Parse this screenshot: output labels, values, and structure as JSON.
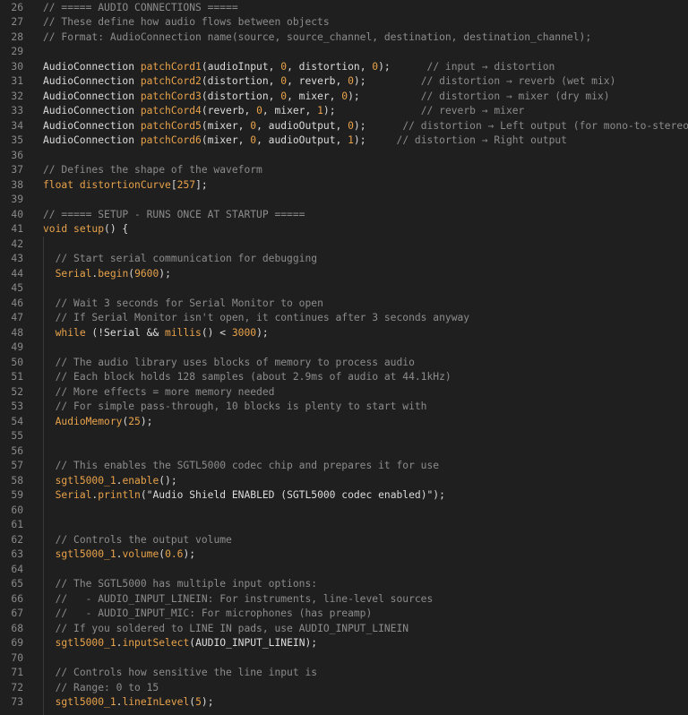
{
  "lines": [
    {
      "n": "26",
      "segs": [
        [
          "c",
          "// ===== AUDIO CONNECTIONS ====="
        ]
      ]
    },
    {
      "n": "27",
      "segs": [
        [
          "c",
          "// These define how audio flows between objects"
        ]
      ]
    },
    {
      "n": "28",
      "segs": [
        [
          "c",
          "// Format: AudioConnection name(source, source_channel, destination, destination_channel);"
        ]
      ]
    },
    {
      "n": "29",
      "segs": []
    },
    {
      "n": "30",
      "segs": [
        [
          "p",
          "AudioConnection "
        ],
        [
          "f",
          "patchCord1"
        ],
        [
          "p",
          "(audioInput, "
        ],
        [
          "n",
          "0"
        ],
        [
          "p",
          ", distortion, "
        ],
        [
          "n",
          "0"
        ],
        [
          "p",
          ");      "
        ],
        [
          "c",
          "// input → distortion"
        ]
      ]
    },
    {
      "n": "31",
      "segs": [
        [
          "p",
          "AudioConnection "
        ],
        [
          "f",
          "patchCord2"
        ],
        [
          "p",
          "(distortion, "
        ],
        [
          "n",
          "0"
        ],
        [
          "p",
          ", reverb, "
        ],
        [
          "n",
          "0"
        ],
        [
          "p",
          ");         "
        ],
        [
          "c",
          "// distortion → reverb (wet mix)"
        ]
      ]
    },
    {
      "n": "32",
      "segs": [
        [
          "p",
          "AudioConnection "
        ],
        [
          "f",
          "patchCord3"
        ],
        [
          "p",
          "(distortion, "
        ],
        [
          "n",
          "0"
        ],
        [
          "p",
          ", mixer, "
        ],
        [
          "n",
          "0"
        ],
        [
          "p",
          ");          "
        ],
        [
          "c",
          "// distortion → mixer (dry mix)"
        ]
      ]
    },
    {
      "n": "33",
      "segs": [
        [
          "p",
          "AudioConnection "
        ],
        [
          "f",
          "patchCord4"
        ],
        [
          "p",
          "(reverb, "
        ],
        [
          "n",
          "0"
        ],
        [
          "p",
          ", mixer, "
        ],
        [
          "n",
          "1"
        ],
        [
          "p",
          ");              "
        ],
        [
          "c",
          "// reverb → mixer"
        ]
      ]
    },
    {
      "n": "34",
      "segs": [
        [
          "p",
          "AudioConnection "
        ],
        [
          "f",
          "patchCord5"
        ],
        [
          "p",
          "(mixer, "
        ],
        [
          "n",
          "0"
        ],
        [
          "p",
          ", audioOutput, "
        ],
        [
          "n",
          "0"
        ],
        [
          "p",
          ");      "
        ],
        [
          "c",
          "// distortion → Left output (for mono-to-stereo)"
        ]
      ]
    },
    {
      "n": "35",
      "segs": [
        [
          "p",
          "AudioConnection "
        ],
        [
          "f",
          "patchCord6"
        ],
        [
          "p",
          "(mixer, "
        ],
        [
          "n",
          "0"
        ],
        [
          "p",
          ", audioOutput, "
        ],
        [
          "n",
          "1"
        ],
        [
          "p",
          ");     "
        ],
        [
          "c",
          "// distortion → Right output"
        ]
      ]
    },
    {
      "n": "36",
      "segs": []
    },
    {
      "n": "37",
      "segs": [
        [
          "c",
          "// Defines the shape of the waveform"
        ]
      ]
    },
    {
      "n": "38",
      "segs": [
        [
          "k",
          "float "
        ],
        [
          "f",
          "distortionCurve"
        ],
        [
          "p",
          "["
        ],
        [
          "n",
          "257"
        ],
        [
          "p",
          "];"
        ]
      ]
    },
    {
      "n": "39",
      "segs": []
    },
    {
      "n": "40",
      "segs": [
        [
          "c",
          "// ===== SETUP - RUNS ONCE AT STARTUP ====="
        ]
      ]
    },
    {
      "n": "41",
      "segs": [
        [
          "k",
          "void "
        ],
        [
          "f",
          "setup"
        ],
        [
          "p",
          "() {"
        ]
      ]
    },
    {
      "n": "42",
      "segs": []
    },
    {
      "n": "43",
      "segs": [
        [
          "p",
          "  "
        ],
        [
          "c",
          "// Start serial communication for debugging"
        ]
      ]
    },
    {
      "n": "44",
      "segs": [
        [
          "p",
          "  "
        ],
        [
          "k",
          "Serial"
        ],
        [
          "p",
          "."
        ],
        [
          "f",
          "begin"
        ],
        [
          "p",
          "("
        ],
        [
          "n",
          "9600"
        ],
        [
          "p",
          ");"
        ]
      ]
    },
    {
      "n": "45",
      "segs": []
    },
    {
      "n": "46",
      "segs": [
        [
          "p",
          "  "
        ],
        [
          "c",
          "// Wait 3 seconds for Serial Monitor to open"
        ]
      ]
    },
    {
      "n": "47",
      "segs": [
        [
          "p",
          "  "
        ],
        [
          "c",
          "// If Serial Monitor isn't open, it continues after 3 seconds anyway"
        ]
      ]
    },
    {
      "n": "48",
      "segs": [
        [
          "p",
          "  "
        ],
        [
          "k",
          "while"
        ],
        [
          "p",
          " (!Serial && "
        ],
        [
          "f",
          "millis"
        ],
        [
          "p",
          "() < "
        ],
        [
          "n",
          "3000"
        ],
        [
          "p",
          ");"
        ]
      ]
    },
    {
      "n": "49",
      "segs": []
    },
    {
      "n": "50",
      "segs": [
        [
          "p",
          "  "
        ],
        [
          "c",
          "// The audio library uses blocks of memory to process audio"
        ]
      ]
    },
    {
      "n": "51",
      "segs": [
        [
          "p",
          "  "
        ],
        [
          "c",
          "// Each block holds 128 samples (about 2.9ms of audio at 44.1kHz)"
        ]
      ]
    },
    {
      "n": "52",
      "segs": [
        [
          "p",
          "  "
        ],
        [
          "c",
          "// More effects = more memory needed"
        ]
      ]
    },
    {
      "n": "53",
      "segs": [
        [
          "p",
          "  "
        ],
        [
          "c",
          "// For simple pass-through, 10 blocks is plenty to start with"
        ]
      ]
    },
    {
      "n": "54",
      "segs": [
        [
          "p",
          "  "
        ],
        [
          "f",
          "AudioMemory"
        ],
        [
          "p",
          "("
        ],
        [
          "n",
          "25"
        ],
        [
          "p",
          ");"
        ]
      ]
    },
    {
      "n": "55",
      "segs": []
    },
    {
      "n": "56",
      "segs": []
    },
    {
      "n": "57",
      "segs": [
        [
          "p",
          "  "
        ],
        [
          "c",
          "// This enables the SGTL5000 codec chip and prepares it for use"
        ]
      ]
    },
    {
      "n": "58",
      "segs": [
        [
          "p",
          "  "
        ],
        [
          "f",
          "sgtl5000_1"
        ],
        [
          "p",
          "."
        ],
        [
          "f",
          "enable"
        ],
        [
          "p",
          "();"
        ]
      ]
    },
    {
      "n": "59",
      "segs": [
        [
          "p",
          "  "
        ],
        [
          "k",
          "Serial"
        ],
        [
          "p",
          "."
        ],
        [
          "f",
          "println"
        ],
        [
          "p",
          "(\"Audio Shield ENABLED (SGTL5000 codec enabled)\");"
        ]
      ]
    },
    {
      "n": "60",
      "segs": []
    },
    {
      "n": "61",
      "segs": []
    },
    {
      "n": "62",
      "segs": [
        [
          "p",
          "  "
        ],
        [
          "c",
          "// Controls the output volume"
        ]
      ]
    },
    {
      "n": "63",
      "segs": [
        [
          "p",
          "  "
        ],
        [
          "f",
          "sgtl5000_1"
        ],
        [
          "p",
          "."
        ],
        [
          "f",
          "volume"
        ],
        [
          "p",
          "("
        ],
        [
          "n",
          "0.6"
        ],
        [
          "p",
          ");"
        ]
      ]
    },
    {
      "n": "64",
      "segs": []
    },
    {
      "n": "65",
      "segs": [
        [
          "p",
          "  "
        ],
        [
          "c",
          "// The SGTL5000 has multiple input options:"
        ]
      ]
    },
    {
      "n": "66",
      "segs": [
        [
          "p",
          "  "
        ],
        [
          "c",
          "//   - AUDIO_INPUT_LINEIN: For instruments, line-level sources"
        ]
      ]
    },
    {
      "n": "67",
      "segs": [
        [
          "p",
          "  "
        ],
        [
          "c",
          "//   - AUDIO_INPUT_MIC: For microphones (has preamp)"
        ]
      ]
    },
    {
      "n": "68",
      "segs": [
        [
          "p",
          "  "
        ],
        [
          "c",
          "// If you soldered to LINE IN pads, use AUDIO_INPUT_LINEIN"
        ]
      ]
    },
    {
      "n": "69",
      "segs": [
        [
          "p",
          "  "
        ],
        [
          "f",
          "sgtl5000_1"
        ],
        [
          "p",
          "."
        ],
        [
          "f",
          "inputSelect"
        ],
        [
          "p",
          "(AUDIO_INPUT_LINEIN);"
        ]
      ]
    },
    {
      "n": "70",
      "segs": []
    },
    {
      "n": "71",
      "segs": [
        [
          "p",
          "  "
        ],
        [
          "c",
          "// Controls how sensitive the line input is"
        ]
      ]
    },
    {
      "n": "72",
      "segs": [
        [
          "p",
          "  "
        ],
        [
          "c",
          "// Range: 0 to 15"
        ]
      ]
    },
    {
      "n": "73",
      "segs": [
        [
          "p",
          "  "
        ],
        [
          "f",
          "sgtl5000_1"
        ],
        [
          "p",
          "."
        ],
        [
          "f",
          "lineInLevel"
        ],
        [
          "p",
          "("
        ],
        [
          "n",
          "5"
        ],
        [
          "p",
          ");"
        ]
      ]
    }
  ]
}
